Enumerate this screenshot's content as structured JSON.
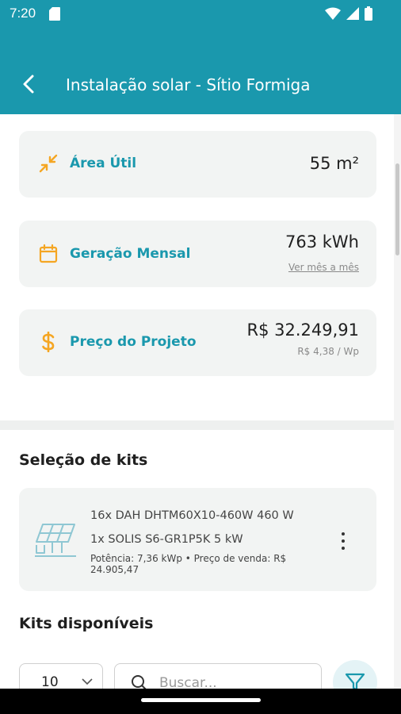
{
  "status_bar": {
    "time": "7:20",
    "icons": [
      "sd-card-icon",
      "wifi-icon",
      "signal-icon",
      "battery-icon"
    ]
  },
  "app_bar": {
    "title": "Instalação solar - Sítio Formiga",
    "back_icon": "arrow-left-icon"
  },
  "summary": {
    "area": {
      "icon": "compress-arrows-icon",
      "label": "Área Útil",
      "value": "55 m²"
    },
    "generation": {
      "icon": "calendar-icon",
      "label": "Geração Mensal",
      "value": "763 kWh",
      "link": "Ver mês a mês"
    },
    "price": {
      "icon": "dollar-icon",
      "label": "Preço do Projeto",
      "value": "R$ 32.249,91",
      "sub": "R$ 4,38 / Wp"
    }
  },
  "kit_selection": {
    "title": "Seleção de kits",
    "kit": {
      "icon": "solar-panel-icon",
      "panel_line": "16x DAH DHTM60X10-460W 460 W",
      "inverter_line": "1x SOLIS S6-GR1P5K 5 kW",
      "meta": "Potência: 7,36 kWp • Preço de venda: R$ 24.905,47",
      "menu_icon": "more-vert-icon"
    }
  },
  "available_kits": {
    "title": "Kits disponíveis",
    "page_size": "10",
    "search_placeholder": "Buscar...",
    "filter_icon": "filter-icon"
  },
  "colors": {
    "primary": "#1a98ad",
    "accent_orange": "#f5a623",
    "card_bg": "#f2f4f3"
  }
}
